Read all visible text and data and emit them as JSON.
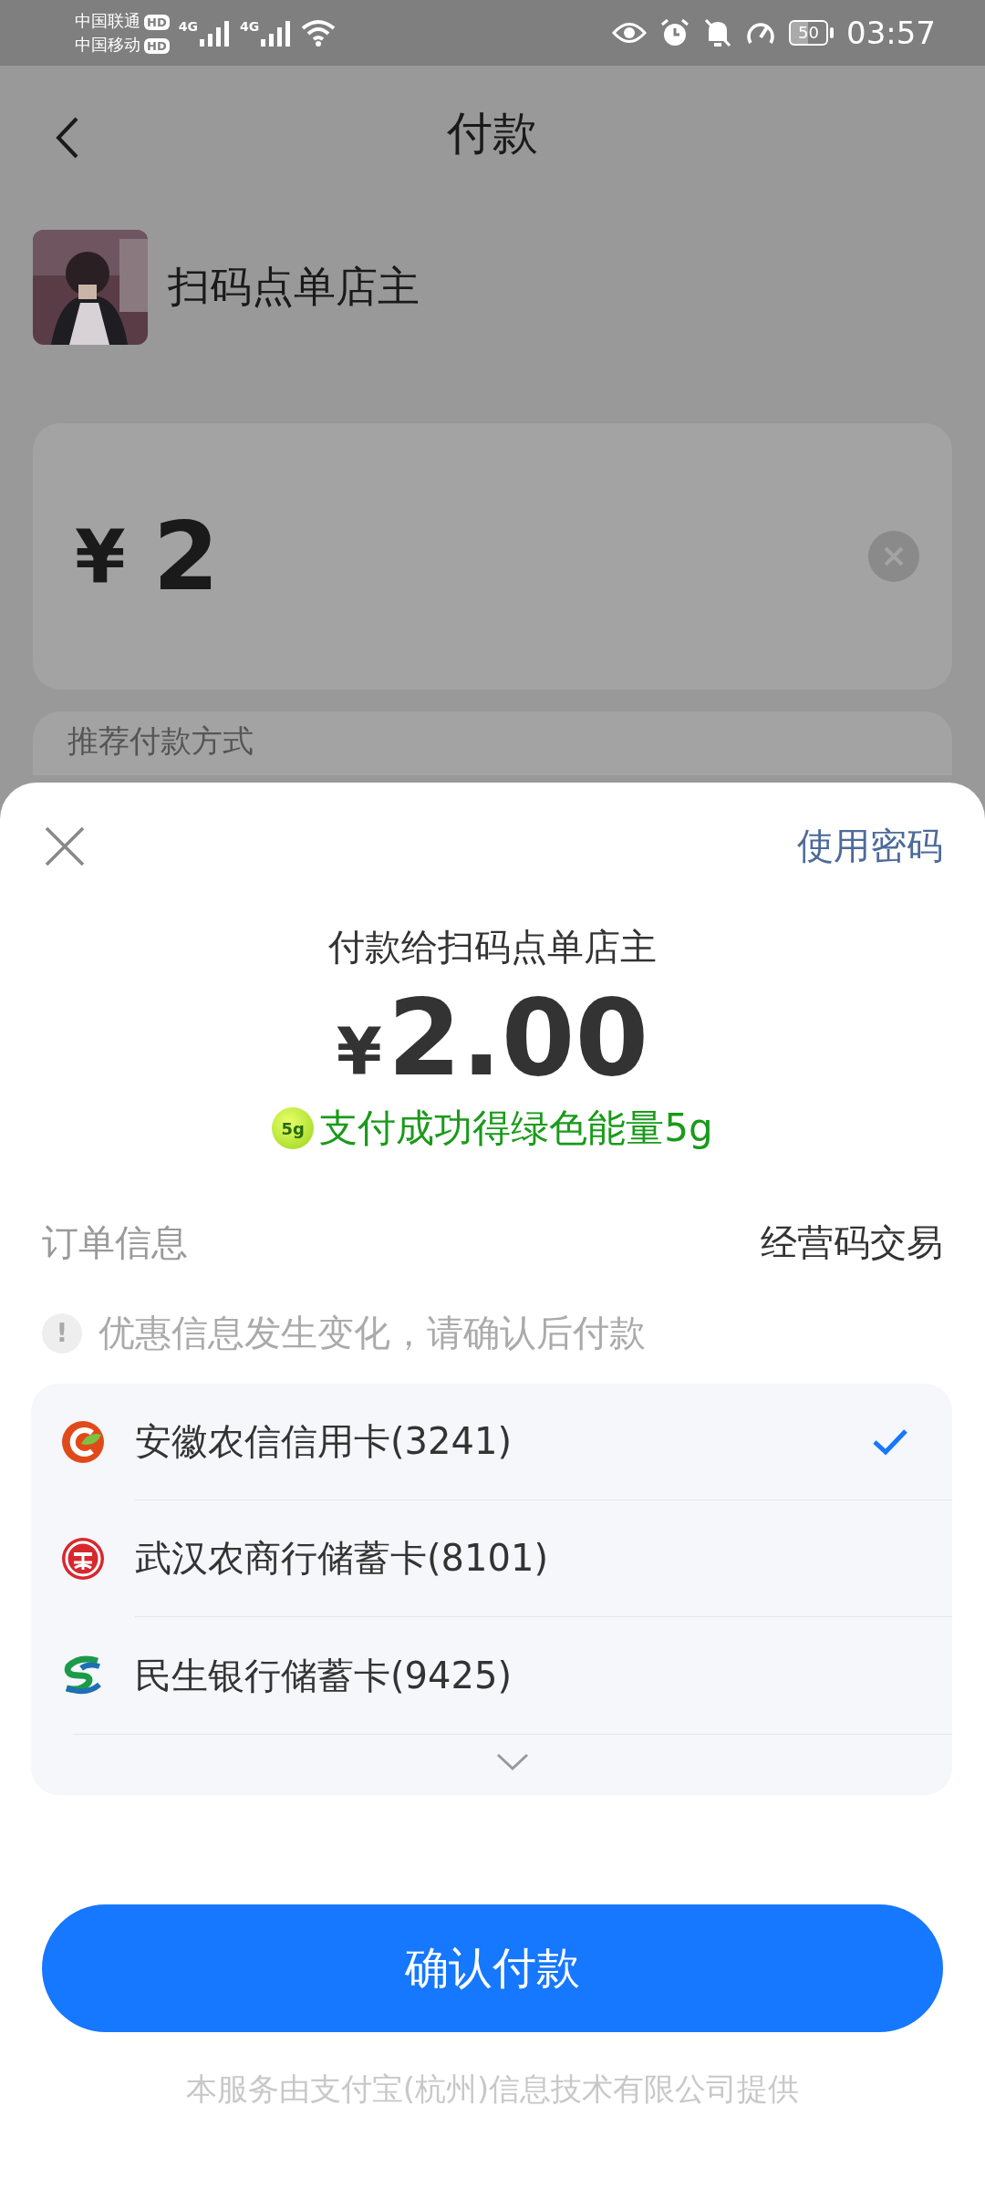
{
  "status_bar": {
    "carriers": [
      {
        "name": "中国联通",
        "badge": "HD"
      },
      {
        "name": "中国移动",
        "badge": "HD"
      }
    ],
    "network_labels": [
      "4G",
      "4G"
    ],
    "battery": "50",
    "time": "03:57"
  },
  "background": {
    "title": "付款",
    "merchant": "扫码点单店主",
    "amount": {
      "currency": "¥",
      "value": "2"
    },
    "section_title": "推荐付款方式"
  },
  "sheet": {
    "right_action": "使用密码",
    "payee": "付款给扫码点单店主",
    "amount": {
      "currency": "¥",
      "value": "2.00"
    },
    "reward": {
      "badge": "5g",
      "text": "支付成功得绿色能量5g"
    },
    "order": {
      "label": "订单信息",
      "value": "经营码交易"
    },
    "notice": {
      "icon": "!",
      "text": "优惠信息发生变化，请确认后付款"
    },
    "cards": [
      {
        "kind": "leaf",
        "name": "安徽农信信用卡(3241)",
        "selected": true
      },
      {
        "kind": "coin",
        "name": "武汉农商行储蓄卡(8101)",
        "selected": false
      },
      {
        "kind": "ribbon",
        "name": "民生银行储蓄卡(9425)",
        "selected": false
      }
    ],
    "confirm": "确认付款",
    "footer": "本服务由支付宝(杭州)信息技术有限公司提供"
  }
}
